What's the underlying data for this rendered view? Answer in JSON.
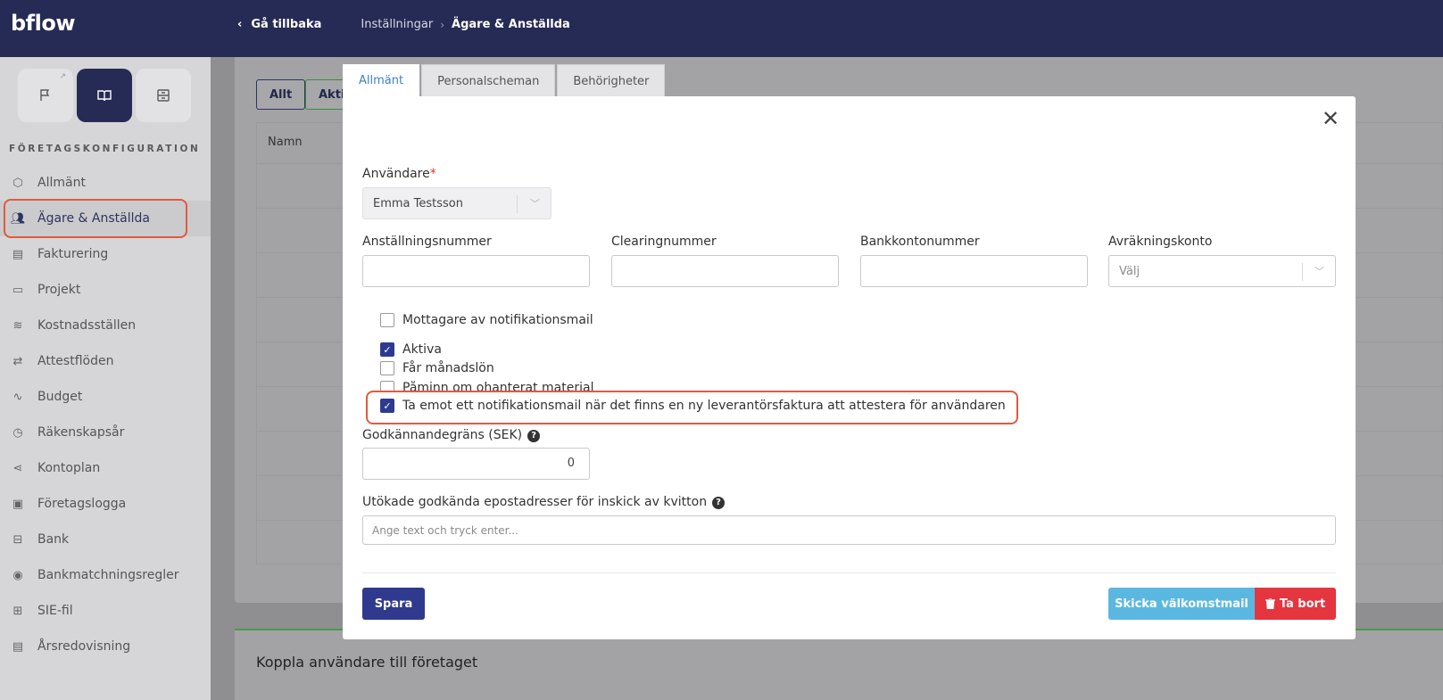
{
  "app": {
    "logo": "bflow"
  },
  "breadcrumb": {
    "back_label": "Gå tillbaka",
    "parent": "Inställningar",
    "separator": "›",
    "current": "Ägare & Anställda"
  },
  "sidebar": {
    "section_title": "FÖRETAGSKONFIGURATION",
    "mode_icons": [
      "flag-icon",
      "book-icon",
      "archive-icon"
    ],
    "items": [
      {
        "label": "Allmänt",
        "icon": "cube-icon",
        "active": false
      },
      {
        "label": "Ägare & Anställda",
        "icon": "users-icon",
        "active": true
      },
      {
        "label": "Fakturering",
        "icon": "document-icon",
        "active": false
      },
      {
        "label": "Projekt",
        "icon": "folder-icon",
        "active": false
      },
      {
        "label": "Kostnadsställen",
        "icon": "layers-icon",
        "active": false
      },
      {
        "label": "Attestflöden",
        "icon": "arrows-icon",
        "active": false
      },
      {
        "label": "Budget",
        "icon": "activity-icon",
        "active": false
      },
      {
        "label": "Räkenskapsår",
        "icon": "clock-icon",
        "active": false
      },
      {
        "label": "Kontoplan",
        "icon": "share-icon",
        "active": false
      },
      {
        "label": "Företagslogga",
        "icon": "image-icon",
        "active": false
      },
      {
        "label": "Bank",
        "icon": "database-icon",
        "active": false
      },
      {
        "label": "Bankmatchningsregler",
        "icon": "eye-icon",
        "active": false
      },
      {
        "label": "SIE-fil",
        "icon": "file-plus-icon",
        "active": false
      },
      {
        "label": "Årsredovisning",
        "icon": "document-icon",
        "active": false
      }
    ]
  },
  "background": {
    "filters": [
      "Allt",
      "Akti"
    ],
    "table_header": "Namn",
    "bottom_card_title": "Koppla användare till företaget"
  },
  "modal": {
    "tabs": [
      "Allmänt",
      "Personalscheman",
      "Behörigheter"
    ],
    "active_tab": "Allmänt",
    "user_label": "Användare",
    "user_required_mark": "*",
    "user_value": "Emma Testsson",
    "employment_number_label": "Anställningsnummer",
    "employment_number_value": "",
    "clearing_label": "Clearingnummer",
    "clearing_value": "",
    "bank_account_label": "Bankkontonummer",
    "bank_account_value": "",
    "settlement_account_label": "Avräkningskonto",
    "settlement_account_placeholder": "Välj",
    "checkboxes": [
      {
        "label": "Mottagare av notifikationsmail",
        "checked": false
      },
      {
        "label": "Aktiva",
        "checked": true
      },
      {
        "label": "Får månadslön",
        "checked": false
      },
      {
        "label": "Påminn om ohanterat material",
        "checked": false
      },
      {
        "label": "Ta emot ett notifikationsmail när det finns en ny leverantörsfaktura att attestera för användaren",
        "checked": true
      }
    ],
    "approval_limit_label": "Godkännandegräns (SEK)",
    "approval_limit_value": "0",
    "emails_label": "Utökade godkända epostadresser för inskick av kvitton",
    "emails_placeholder": "Ange text och tryck enter...",
    "save_button": "Spara",
    "welcome_mail_button": "Skicka välkomstmail",
    "delete_button": "Ta bort"
  },
  "colors": {
    "topbar": "#262b55",
    "primary": "#2f3a8f",
    "info": "#5ab8e0",
    "danger": "#e5353f",
    "highlight": "#e05a3e",
    "tab_active_text": "#3d7fc9"
  }
}
